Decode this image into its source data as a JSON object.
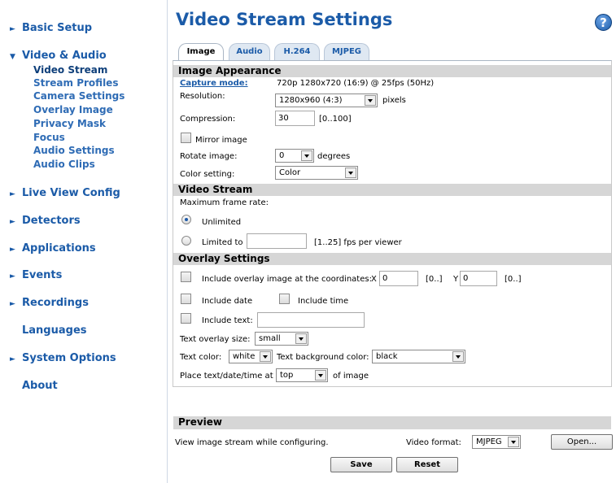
{
  "sidebar": {
    "basic_setup": "Basic Setup",
    "video_audio": "Video & Audio",
    "sub_items": [
      "Video Stream",
      "Stream Profiles",
      "Camera Settings",
      "Overlay Image",
      "Privacy Mask",
      "Focus",
      "Audio Settings",
      "Audio Clips"
    ],
    "live_view": "Live View Config",
    "detectors": "Detectors",
    "applications": "Applications",
    "events": "Events",
    "recordings": "Recordings",
    "languages": "Languages",
    "system_options": "System Options",
    "about": "About"
  },
  "header": {
    "title": "Video Stream Settings",
    "help": "?"
  },
  "tabs": [
    "Image",
    "Audio",
    "H.264",
    "MJPEG"
  ],
  "image_appearance": {
    "heading": "Image Appearance",
    "capture_label": "Capture mode:",
    "capture_value": "720p 1280x720 (16:9) @ 25fps (50Hz)",
    "resolution_label": "Resolution:",
    "resolution_value": "1280x960 (4:3)",
    "resolution_unit": "pixels",
    "compression_label": "Compression:",
    "compression_value": "30",
    "compression_range": "[0..100]",
    "mirror_label": "Mirror image",
    "rotate_label": "Rotate image:",
    "rotate_value": "0",
    "rotate_unit": "degrees",
    "color_label": "Color setting:",
    "color_value": "Color"
  },
  "video_stream": {
    "heading": "Video Stream",
    "max_rate_label": "Maximum frame rate:",
    "unlimited_label": "Unlimited",
    "limited_label": "Limited to",
    "limited_value": "",
    "limited_range": "[1..25] fps per viewer"
  },
  "overlay": {
    "heading": "Overlay Settings",
    "include_overlay_label": "Include overlay image at the coordinates:",
    "x_label": "X",
    "x_value": "0",
    "x_range": "[0..]",
    "y_label": "Y",
    "y_value": "0",
    "y_range": "[0..]",
    "include_date": "Include date",
    "include_time": "Include time",
    "include_text": "Include text:",
    "text_value": "",
    "size_label": "Text overlay size:",
    "size_value": "small",
    "text_color_label": "Text color:",
    "text_color_value": "white",
    "bg_color_label": "Text background color:",
    "bg_color_value": "black",
    "place_label": "Place text/date/time at",
    "place_value": "top",
    "place_suffix": "of image"
  },
  "preview": {
    "heading": "Preview",
    "description": "View image stream while configuring.",
    "format_label": "Video format:",
    "format_value": "MJPEG",
    "open_button": "Open..."
  },
  "actions": {
    "save": "Save",
    "reset": "Reset"
  }
}
